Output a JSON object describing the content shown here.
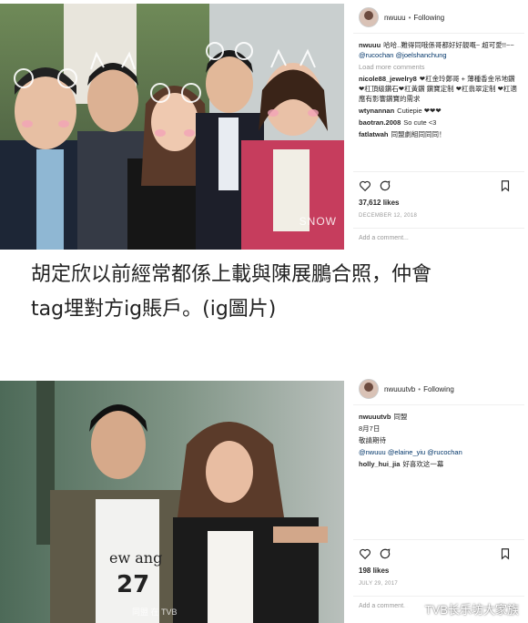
{
  "post1": {
    "username": "nwuuu",
    "follow": "Following",
    "comments": [
      {
        "user": "nwuuu",
        "text": "哈哈..難得同哦係哥都好好靚嘅~ 超可愛!!~~ ",
        "mentions": [
          "@rucochan",
          "@joelshanchung"
        ]
      },
      {
        "user": "",
        "text": "Load more comments",
        "muted": true
      },
      {
        "user": "nicole88_jewelry8",
        "text": "❤杠金玲鄭哥 + 薄種香金吊地鑽 ❤杠頂級鑽石❤杠黃鑽 鑽寶定制 ❤杠翡翠定制 ❤杠適應有影響鑽寶的需求"
      },
      {
        "user": "wtynannan",
        "text": "Cutiepie ❤❤❤"
      },
      {
        "user": "baotran.2008",
        "text": "So cute <3"
      },
      {
        "user": "fatlatwah",
        "text": "同盟劇組同同同！"
      }
    ],
    "likes": "37,612 likes",
    "date": "DECEMBER 12, 2018",
    "add_comment": "Add a comment...",
    "photo_mark": "SNOW"
  },
  "caption": {
    "line1": "胡定欣以前經常都係上載與陳展鵬合照，仲會",
    "line2": "tag埋對方ig賬戶。(ig圖片)"
  },
  "post2": {
    "username": "nwuuutvb",
    "follow": "Following",
    "comments": [
      {
        "user": "nwuuutvb",
        "text": "同盟"
      },
      {
        "user": "",
        "text": "8月7日"
      },
      {
        "user": "",
        "text": "敬請期待"
      },
      {
        "user": "",
        "text": "",
        "mentions": [
          "@nwuuu",
          "@elaine_yiu",
          "@rucochan"
        ]
      },
      {
        "user": "holly_hui_jia",
        "text": "好喜欢这一幕"
      }
    ],
    "likes": "198 likes",
    "date": "JULY 29, 2017",
    "add_comment": "Add a comment...",
    "subtitle": "同盟 在 TVB",
    "watermark": "TVB长乐坊大家族"
  }
}
